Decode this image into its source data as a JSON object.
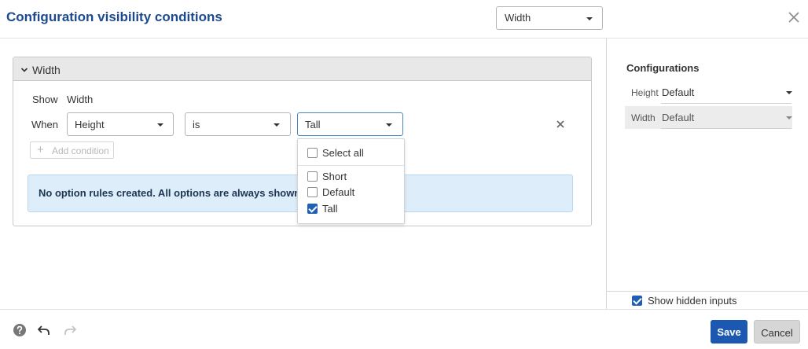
{
  "dialog": {
    "title": "Configuration visibility conditions",
    "config_select_value": "Width"
  },
  "panel": {
    "header_label": "Width",
    "show_label": "Show",
    "show_value": "Width",
    "when_label": "When",
    "condition": {
      "input_value": "Height",
      "operator_value": "is",
      "option_value": "Tall"
    },
    "add_condition_label": "Add condition",
    "info_message": "No option rules created. All options are always shown."
  },
  "dropdown": {
    "select_all_label": "Select all",
    "select_all_checked": false,
    "options": [
      {
        "label": "Short",
        "checked": false
      },
      {
        "label": "Default",
        "checked": false
      },
      {
        "label": "Tall",
        "checked": true
      }
    ]
  },
  "sidebar": {
    "title": "Configurations",
    "rows": [
      {
        "name": "Height",
        "value": "Default",
        "disabled": false
      },
      {
        "name": "Width",
        "value": "Default",
        "disabled": true
      }
    ],
    "show_hidden_label": "Show hidden inputs",
    "show_hidden_checked": true
  },
  "footer": {
    "save_label": "Save",
    "cancel_label": "Cancel"
  },
  "icons": {
    "help": "help-circle-icon",
    "undo": "undo-icon",
    "redo": "redo-icon",
    "close": "close-icon",
    "chevron": "chevron-down-icon"
  },
  "colors": {
    "title": "#1b4a8f",
    "primary_button": "#1d58b0",
    "info_background": "#ddeefa",
    "checkbox_checked": "#1f5fb5"
  }
}
